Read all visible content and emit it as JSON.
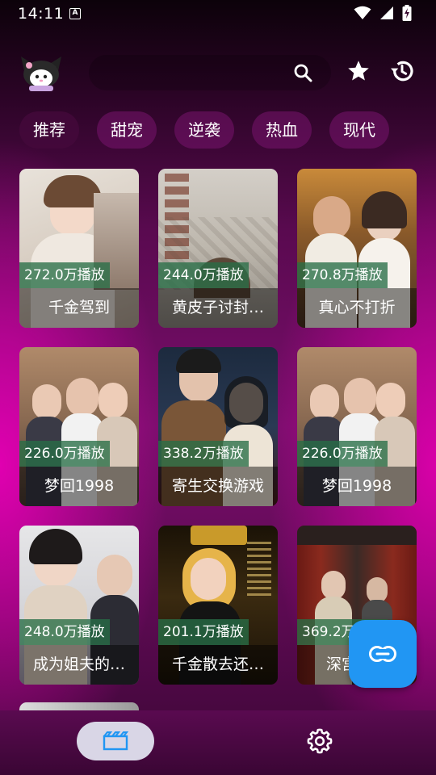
{
  "status_bar": {
    "time": "14:11",
    "notification_glyph": "A",
    "icons": [
      "wifi-icon",
      "signal-icon",
      "battery-charging-icon"
    ]
  },
  "header": {
    "avatar": "kuromi-avatar",
    "icons": [
      "search-icon",
      "star-icon",
      "history-icon"
    ]
  },
  "tabs": [
    {
      "label": "推荐",
      "active": true
    },
    {
      "label": "甜宠",
      "active": false
    },
    {
      "label": "逆袭",
      "active": false
    },
    {
      "label": "热血",
      "active": false
    },
    {
      "label": "现代",
      "active": false
    }
  ],
  "cards": [
    {
      "views": "272.0万播放",
      "title": "千金驾到"
    },
    {
      "views": "244.0万播放",
      "title": "黄皮子讨封…"
    },
    {
      "views": "270.8万播放",
      "title": "真心不打折"
    },
    {
      "views": "226.0万播放",
      "title": "梦回1998"
    },
    {
      "views": "338.2万播放",
      "title": "寄生交换游戏"
    },
    {
      "views": "226.0万播放",
      "title": "梦回1998"
    },
    {
      "views": "248.0万播放",
      "title": "成为姐夫的…"
    },
    {
      "views": "201.1万播放",
      "title": "千金散去还…"
    },
    {
      "views": "369.2万播放",
      "title": "深宫凤…"
    }
  ],
  "fab": {
    "icon": "link-icon"
  },
  "bottom_nav": [
    {
      "icon": "videos-icon",
      "active": true
    },
    {
      "icon": "settings-gear-icon",
      "active": false
    }
  ],
  "colors": {
    "accent": "#2196f3",
    "views_badge": "#286e46",
    "nav_active": "#d9d6e6"
  }
}
